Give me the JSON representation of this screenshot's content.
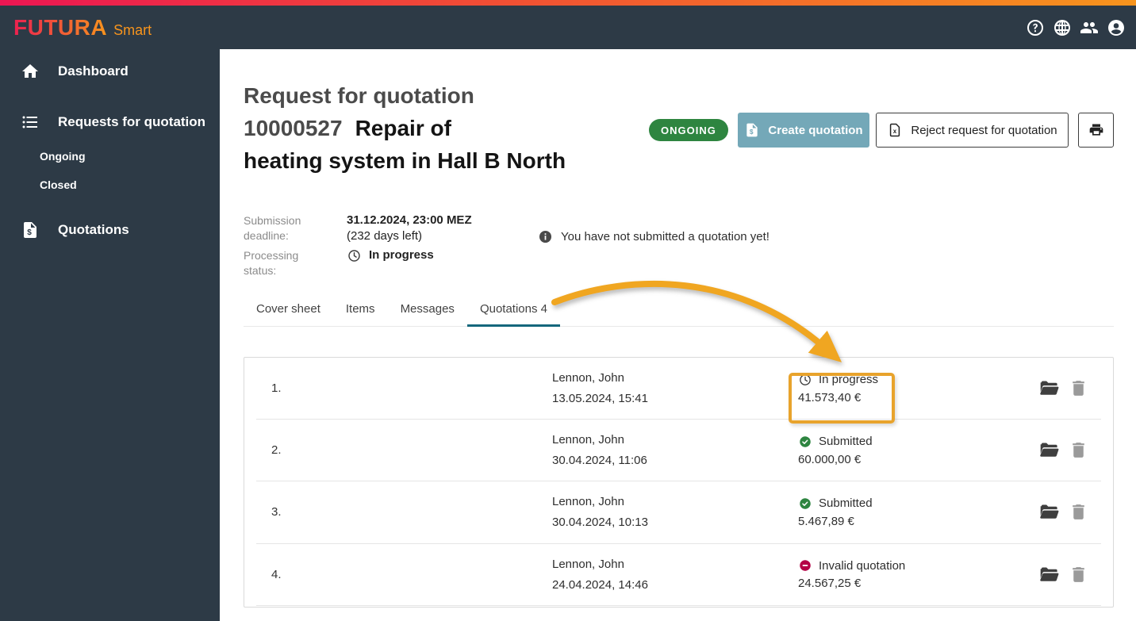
{
  "header": {
    "brand": "FUTURA",
    "brand_suffix": "Smart",
    "icons": [
      "help-icon",
      "globe-icon",
      "users-icon",
      "account-icon"
    ]
  },
  "sidebar": {
    "items": [
      {
        "label": "Dashboard",
        "icon": "home-icon"
      },
      {
        "label": "Requests for quotation",
        "icon": "list-icon",
        "children": [
          {
            "label": "Ongoing"
          },
          {
            "label": "Closed"
          }
        ]
      },
      {
        "label": "Quotations",
        "icon": "quote-document-icon"
      }
    ]
  },
  "page": {
    "title": "Request for quotation",
    "number": "10000527",
    "subject_line1": "Repair of",
    "subject_line2": "heating system in Hall B North",
    "status_badge": "ONGOING",
    "actions": {
      "create": "Create quotation",
      "reject": "Reject request for quotation",
      "print": "print-icon"
    }
  },
  "details": {
    "submission_deadline_label": "Submission deadline:",
    "submission_deadline_value": "31.12.2024, 23:00 MEZ",
    "submission_deadline_note": "(232 days left)",
    "processing_status_label": "Processing status:",
    "processing_status_value": "In progress",
    "info_message": "You have not submitted a quotation yet!"
  },
  "tabs": [
    {
      "label": "Cover sheet",
      "active": false
    },
    {
      "label": "Items",
      "active": false
    },
    {
      "label": "Messages",
      "active": false
    },
    {
      "label": "Quotations 4",
      "active": true
    }
  ],
  "quotations": {
    "rows": [
      {
        "index": "1.",
        "name": "Lennon, John",
        "date": "13.05.2024, 15:41",
        "status": "In progress",
        "status_type": "in-progress",
        "amount": "41.573,40 €",
        "highlighted": true
      },
      {
        "index": "2.",
        "name": "Lennon, John",
        "date": "30.04.2024, 11:06",
        "status": "Submitted",
        "status_type": "submitted",
        "amount": "60.000,00 €",
        "highlighted": false
      },
      {
        "index": "3.",
        "name": "Lennon, John",
        "date": "30.04.2024, 10:13",
        "status": "Submitted",
        "status_type": "submitted",
        "amount": "5.467,89 €",
        "highlighted": false
      },
      {
        "index": "4.",
        "name": "Lennon, John",
        "date": "24.04.2024, 14:46",
        "status": "Invalid quotation",
        "status_type": "invalid",
        "amount": "24.567,25 €",
        "highlighted": false
      }
    ]
  },
  "colors": {
    "top_gradient_from": "#ec1653",
    "top_gradient_to": "#f7941d",
    "header_bg": "#2d3a46",
    "badge_green": "#2e8540",
    "create_button_teal": "#74a8b8",
    "tab_active_teal": "#15677c",
    "status_green": "#2e8540",
    "status_red": "#b40045",
    "annotation_orange": "#f0a621"
  }
}
